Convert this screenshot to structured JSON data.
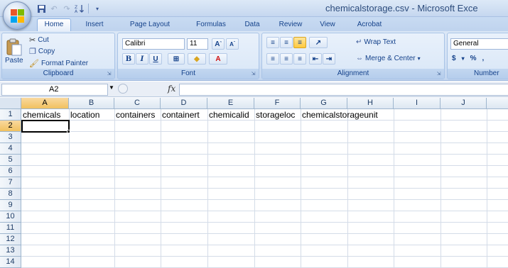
{
  "window": {
    "title": "chemicalstorage.csv - Microsoft Exce"
  },
  "qat": {
    "icons": [
      "save-icon",
      "undo-icon",
      "redo-icon",
      "sort-icon",
      "customize-icon"
    ]
  },
  "tabs": [
    "Home",
    "Insert",
    "Page Layout",
    "Formulas",
    "Data",
    "Review",
    "View",
    "Acrobat"
  ],
  "active_tab": "Home",
  "clipboard": {
    "group_label": "Clipboard",
    "paste_label": "Paste",
    "cut_label": "Cut",
    "copy_label": "Copy",
    "format_painter_label": "Format Painter"
  },
  "font": {
    "group_label": "Font",
    "font_name": "Calibri",
    "font_size": "11",
    "bold": "B",
    "italic": "I",
    "underline": "U"
  },
  "alignment": {
    "group_label": "Alignment",
    "wrap_text_label": "Wrap Text",
    "merge_center_label": "Merge & Center"
  },
  "number": {
    "group_label": "Number",
    "format_value": "General",
    "currency": "$",
    "percent": "%",
    "comma": ","
  },
  "formula_bar": {
    "name_box": "A2",
    "fx": "fx",
    "formula": ""
  },
  "sheet": {
    "columns": [
      "A",
      "B",
      "C",
      "D",
      "E",
      "F",
      "G",
      "H",
      "I",
      "J"
    ],
    "rows": [
      "1",
      "2",
      "3",
      "4",
      "5",
      "6",
      "7",
      "8",
      "9",
      "10",
      "11",
      "12",
      "13",
      "14"
    ],
    "selected_cell": "A2",
    "row1_cells": [
      "chemicals",
      "location",
      "containers",
      "containert",
      "chemicalid",
      "storageloc",
      "chemicalstorageunit",
      "",
      "",
      ""
    ]
  },
  "colors": {
    "accent": "#15428b",
    "selection_header": "#f1c15f"
  }
}
